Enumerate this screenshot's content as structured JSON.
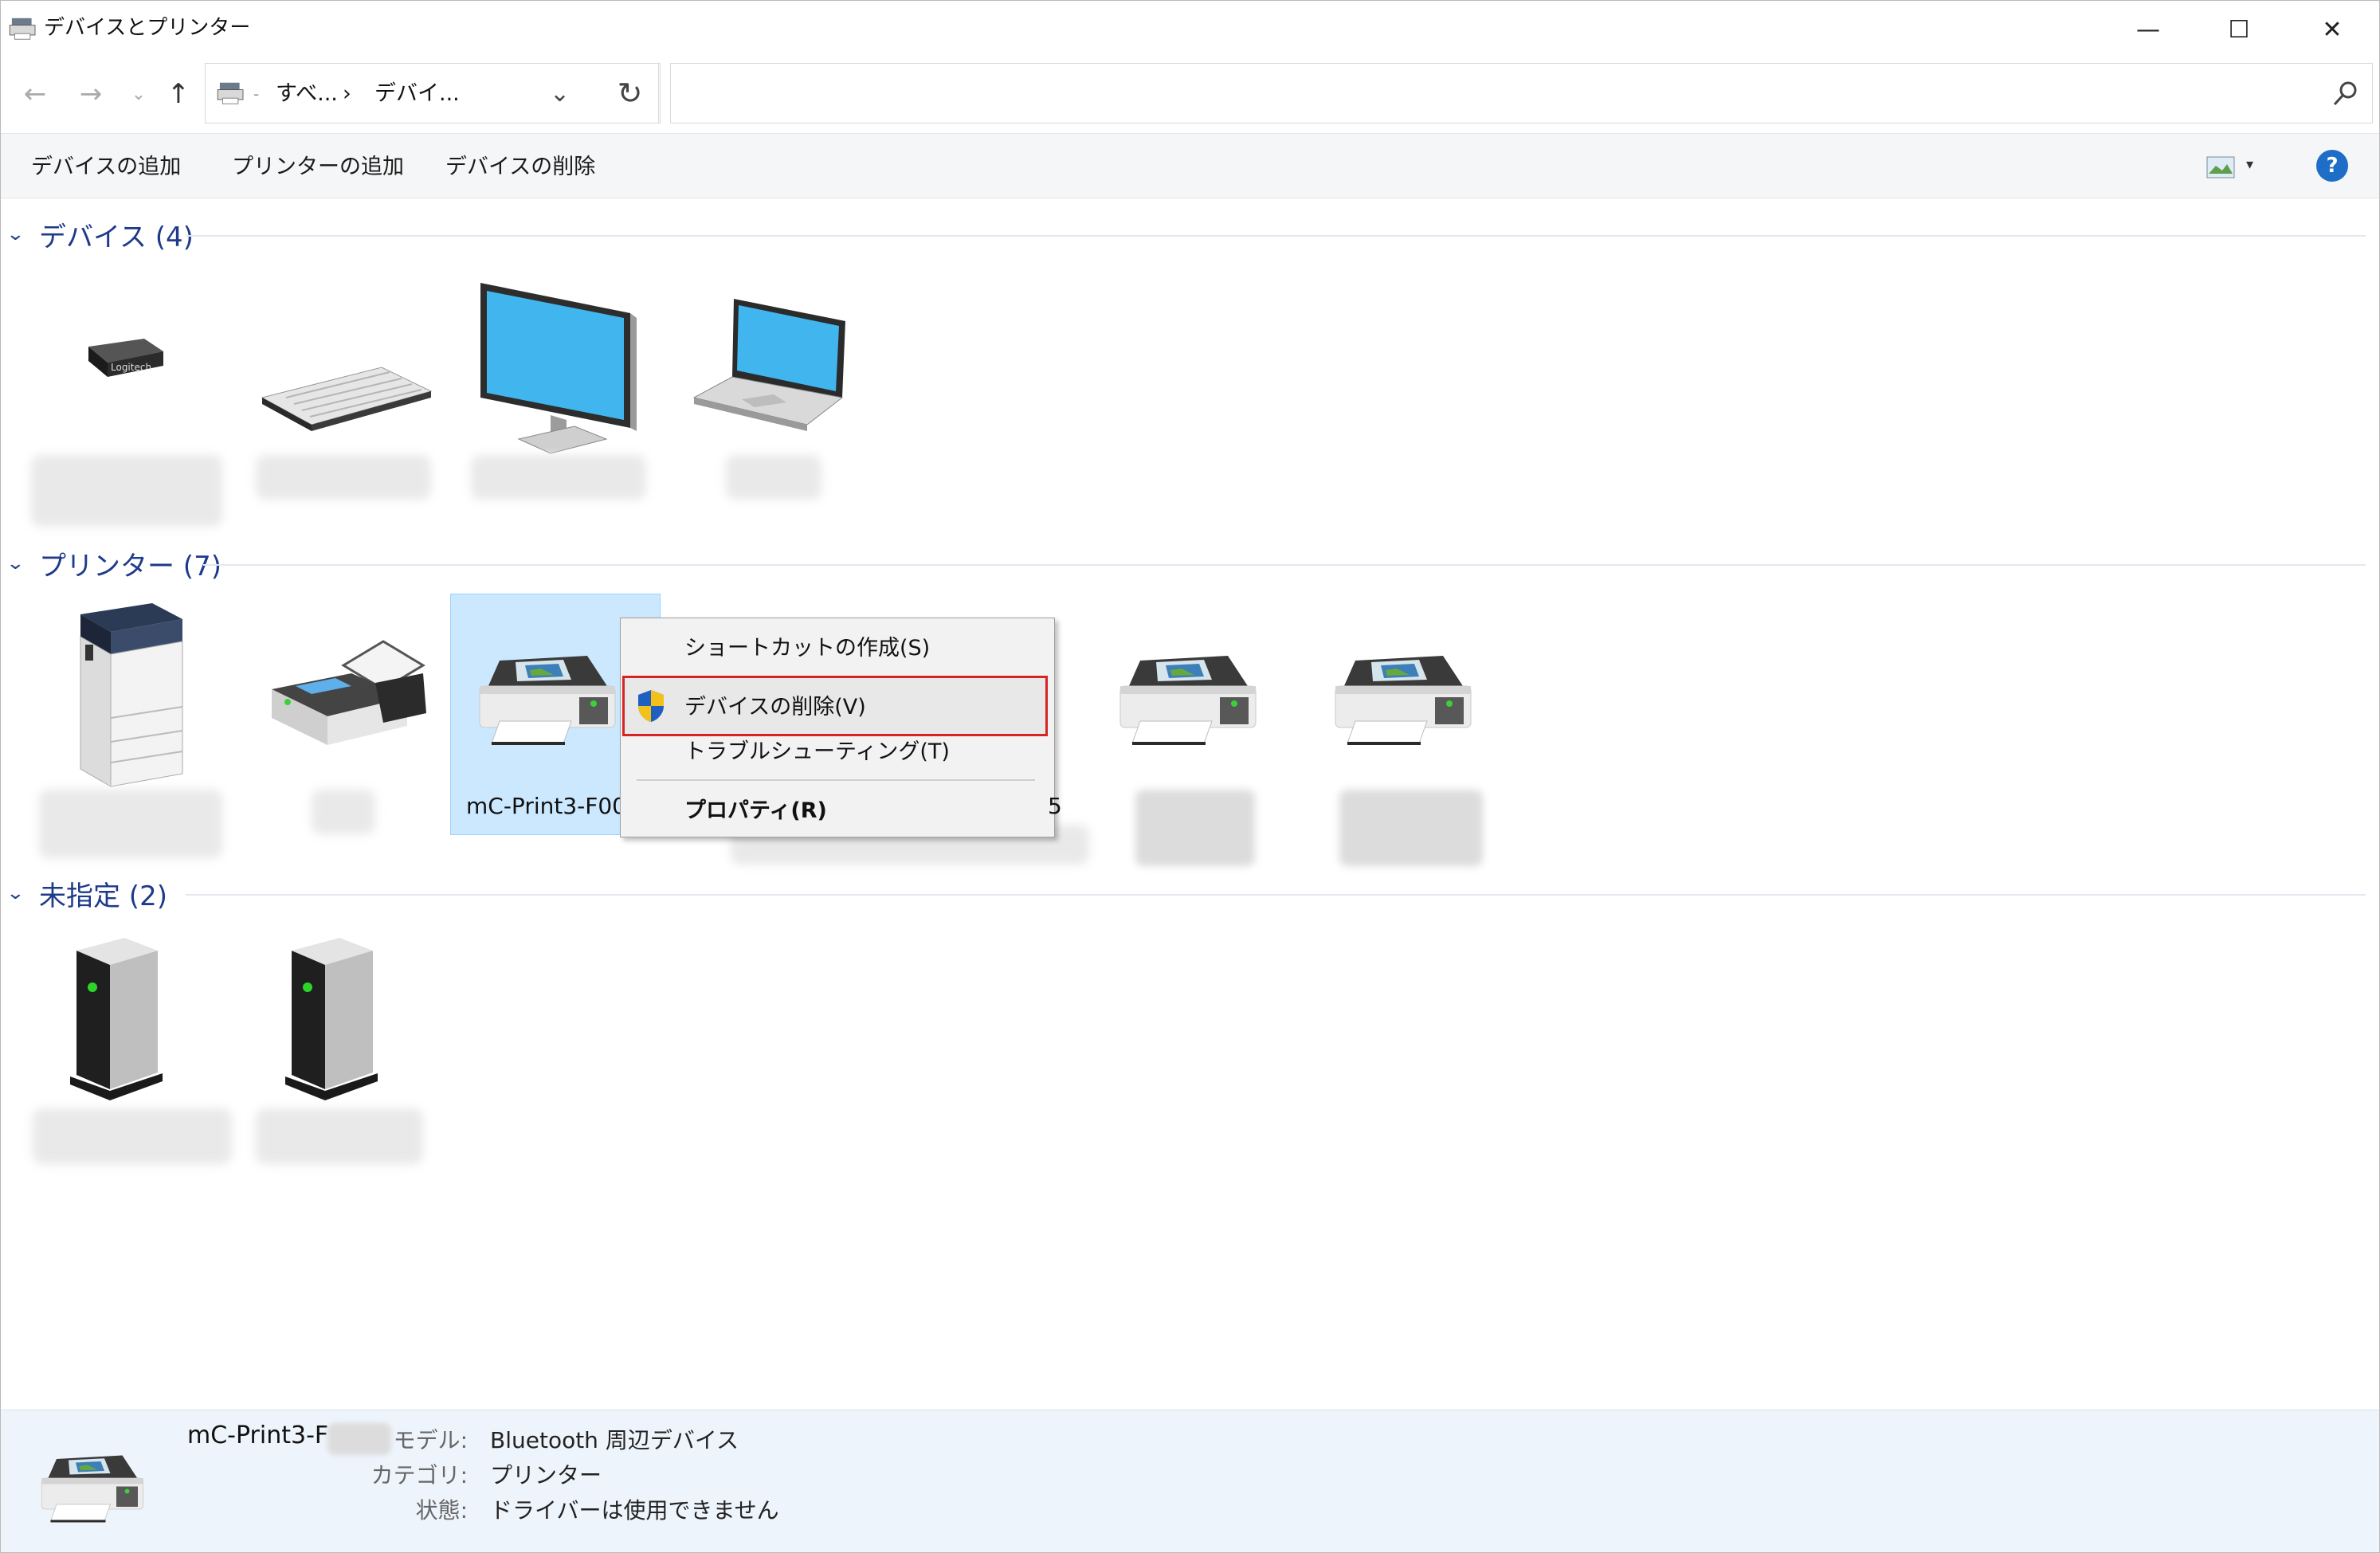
{
  "window": {
    "title": "デバイスとプリンター",
    "controls": {
      "minimize": "—",
      "maximize": "☐",
      "close": "✕"
    }
  },
  "nav": {
    "back_icon": "arrow-left-icon",
    "forward_icon": "arrow-right-icon",
    "up_icon": "arrow-up-icon",
    "breadcrumb": [
      "すべ...",
      "デバイ..."
    ],
    "separator": "›",
    "search_placeholder": ""
  },
  "toolbar": {
    "add_device": "デバイスの追加",
    "add_printer": "プリンターの追加",
    "remove_device": "デバイスの削除",
    "help": "?"
  },
  "groups": {
    "devices": {
      "title": "デバイス (4)"
    },
    "printers": {
      "title": "プリンター (7)"
    },
    "unspecified": {
      "title": "未指定 (2)"
    }
  },
  "devices": [
    {
      "icon": "usb-receiver-icon",
      "badge": "Logitech"
    },
    {
      "icon": "keyboard-icon"
    },
    {
      "icon": "monitor-icon"
    },
    {
      "icon": "laptop-icon"
    }
  ],
  "printers": [
    {
      "icon": "multifunction-printer-icon"
    },
    {
      "icon": "fax-icon"
    },
    {
      "icon": "printer-icon",
      "label": "mC-Print3-F00",
      "selected": true
    },
    {
      "icon": "printer-icon"
    },
    {
      "icon": "printer-icon"
    },
    {
      "icon": "printer-icon"
    }
  ],
  "unspecified": [
    {
      "icon": "server-icon"
    },
    {
      "icon": "server-icon"
    }
  ],
  "context_menu": {
    "create_shortcut": "ショートカットの作成(S)",
    "remove_device": "デバイスの削除(V)",
    "troubleshoot": "トラブルシューティング(T)",
    "properties": "プロパティ(R)",
    "partial_glyph": "5"
  },
  "details": {
    "name": "mC-Print3-F",
    "model_label": "モデル:",
    "model_value": "Bluetooth 周辺デバイス",
    "category_label": "カテゴリ:",
    "category_value": "プリンター",
    "status_label": "状態:",
    "status_value": "ドライバーは使用できません"
  },
  "colors": {
    "accent": "#1e3a8a",
    "selection": "#cce8ff",
    "highlight_border": "#d62424",
    "details_bg": "#eef4fb"
  }
}
